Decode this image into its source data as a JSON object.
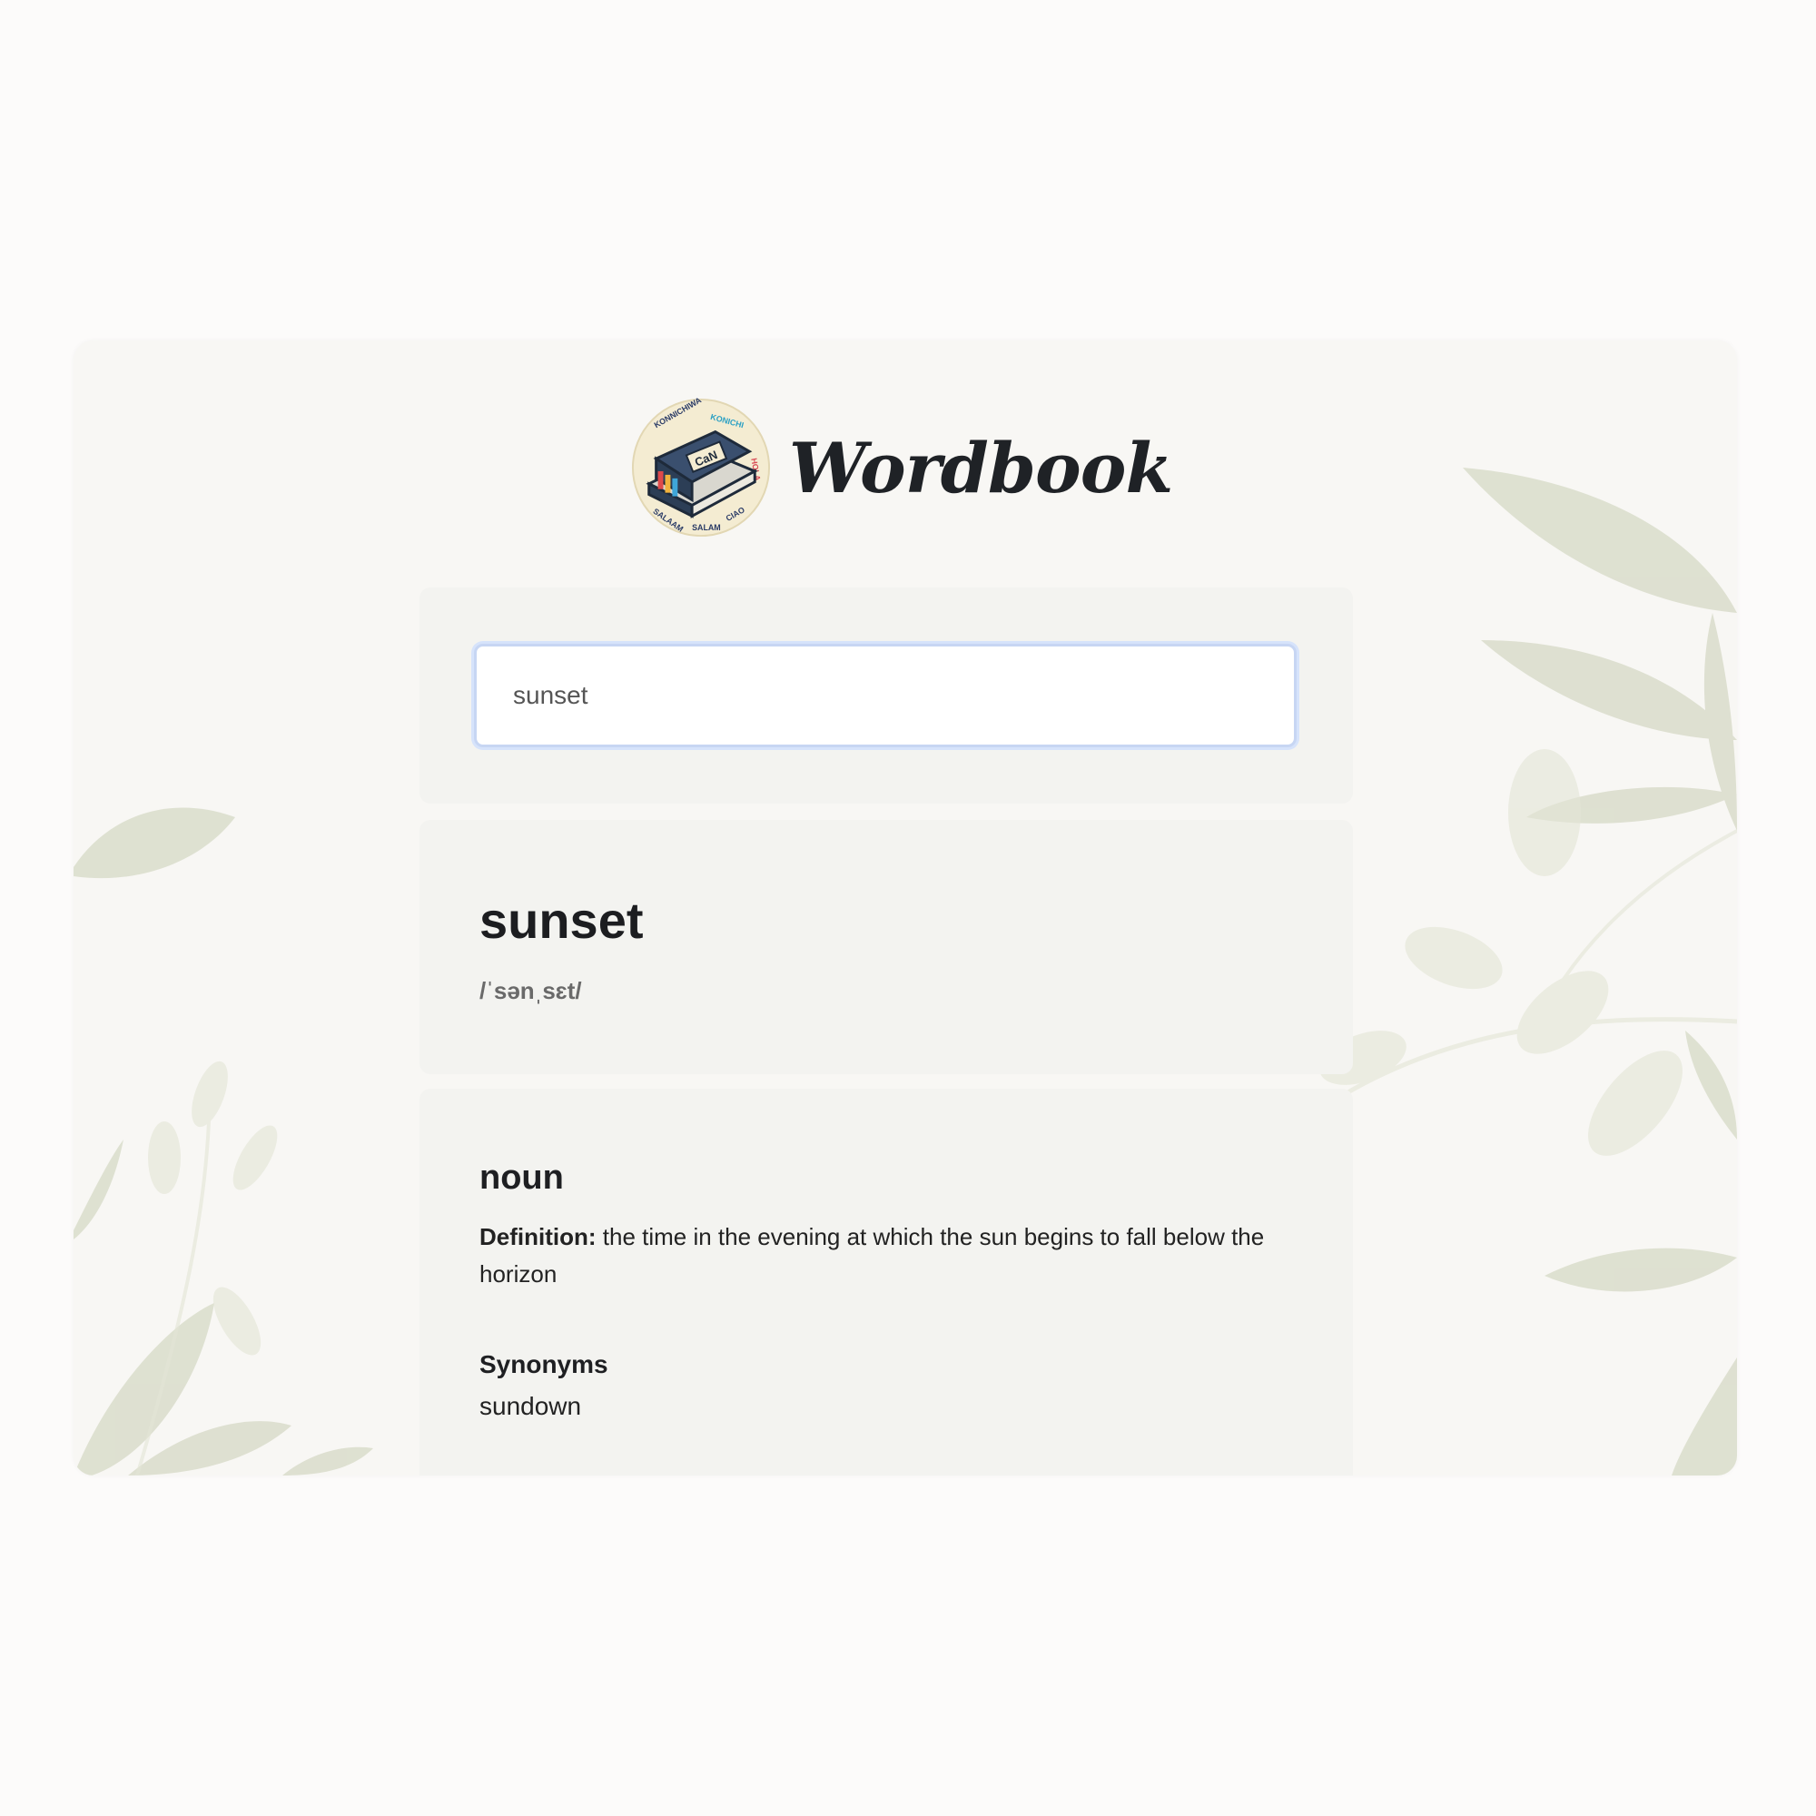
{
  "app": {
    "brand": "Wordbook"
  },
  "search": {
    "value": "sunset"
  },
  "entry": {
    "word": "sunset",
    "phonetic": "/ˈsənˌsɛt/",
    "part_of_speech": "noun",
    "definition_label": "Definition:",
    "definition_text": "the time in the evening at which the sun begins to fall below the horizon",
    "synonyms_heading": "Synonyms",
    "synonyms": "sundown"
  },
  "icons": {
    "logo": "dictionary-book-logo-icon"
  },
  "colors": {
    "page_bg": "#fcfbfa",
    "card_bg": "#f3f3f0",
    "focus_border": "#c7d6f3",
    "leaf": "#d5d8c4"
  }
}
